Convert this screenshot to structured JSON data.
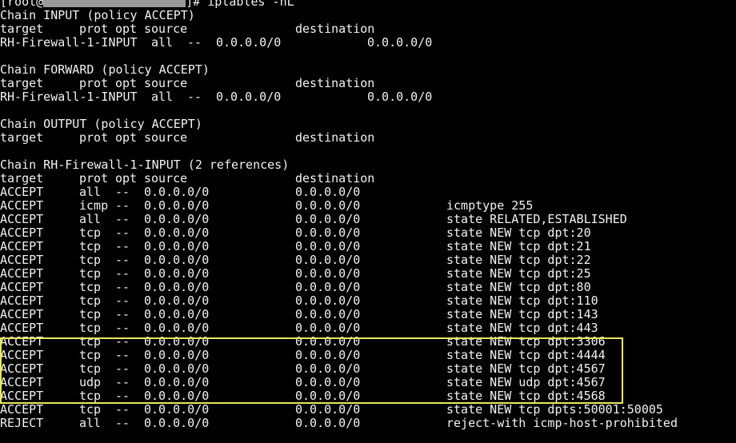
{
  "prompt": {
    "user_host_prefix": "[root@",
    "user_host_suffix": "]#",
    "command": " iptables -nL"
  },
  "chains": {
    "input": {
      "header": "Chain INPUT (policy ACCEPT)",
      "columns": [
        "target",
        "prot",
        "opt",
        "source",
        "destination"
      ],
      "row": {
        "target": "RH-Firewall-1-INPUT",
        "prot": "all",
        "opt": "--",
        "source": "0.0.0.0/0",
        "destination": "0.0.0.0/0"
      }
    },
    "forward": {
      "header": "Chain FORWARD (policy ACCEPT)",
      "columns": [
        "target",
        "prot",
        "opt",
        "source",
        "destination"
      ],
      "row": {
        "target": "RH-Firewall-1-INPUT",
        "prot": "all",
        "opt": "--",
        "source": "0.0.0.0/0",
        "destination": "0.0.0.0/0"
      }
    },
    "output": {
      "header": "Chain OUTPUT (policy ACCEPT)",
      "columns": [
        "target",
        "prot",
        "opt",
        "source",
        "destination"
      ]
    },
    "rh_firewall": {
      "header": "Chain RH-Firewall-1-INPUT (2 references)",
      "columns": [
        "target",
        "prot",
        "opt",
        "source",
        "destination"
      ],
      "rules": [
        {
          "target": "ACCEPT",
          "prot": "all",
          "opt": "--",
          "source": "0.0.0.0/0",
          "destination": "0.0.0.0/0",
          "extra": ""
        },
        {
          "target": "ACCEPT",
          "prot": "icmp",
          "opt": "--",
          "source": "0.0.0.0/0",
          "destination": "0.0.0.0/0",
          "extra": "icmptype 255"
        },
        {
          "target": "ACCEPT",
          "prot": "all",
          "opt": "--",
          "source": "0.0.0.0/0",
          "destination": "0.0.0.0/0",
          "extra": "state RELATED,ESTABLISHED"
        },
        {
          "target": "ACCEPT",
          "prot": "tcp",
          "opt": "--",
          "source": "0.0.0.0/0",
          "destination": "0.0.0.0/0",
          "extra": "state NEW tcp dpt:20"
        },
        {
          "target": "ACCEPT",
          "prot": "tcp",
          "opt": "--",
          "source": "0.0.0.0/0",
          "destination": "0.0.0.0/0",
          "extra": "state NEW tcp dpt:21"
        },
        {
          "target": "ACCEPT",
          "prot": "tcp",
          "opt": "--",
          "source": "0.0.0.0/0",
          "destination": "0.0.0.0/0",
          "extra": "state NEW tcp dpt:22"
        },
        {
          "target": "ACCEPT",
          "prot": "tcp",
          "opt": "--",
          "source": "0.0.0.0/0",
          "destination": "0.0.0.0/0",
          "extra": "state NEW tcp dpt:25"
        },
        {
          "target": "ACCEPT",
          "prot": "tcp",
          "opt": "--",
          "source": "0.0.0.0/0",
          "destination": "0.0.0.0/0",
          "extra": "state NEW tcp dpt:80"
        },
        {
          "target": "ACCEPT",
          "prot": "tcp",
          "opt": "--",
          "source": "0.0.0.0/0",
          "destination": "0.0.0.0/0",
          "extra": "state NEW tcp dpt:110"
        },
        {
          "target": "ACCEPT",
          "prot": "tcp",
          "opt": "--",
          "source": "0.0.0.0/0",
          "destination": "0.0.0.0/0",
          "extra": "state NEW tcp dpt:143"
        },
        {
          "target": "ACCEPT",
          "prot": "tcp",
          "opt": "--",
          "source": "0.0.0.0/0",
          "destination": "0.0.0.0/0",
          "extra": "state NEW tcp dpt:443"
        },
        {
          "target": "ACCEPT",
          "prot": "tcp",
          "opt": "--",
          "source": "0.0.0.0/0",
          "destination": "0.0.0.0/0",
          "extra": "state NEW tcp dpt:3306"
        },
        {
          "target": "ACCEPT",
          "prot": "tcp",
          "opt": "--",
          "source": "0.0.0.0/0",
          "destination": "0.0.0.0/0",
          "extra": "state NEW tcp dpt:4444"
        },
        {
          "target": "ACCEPT",
          "prot": "tcp",
          "opt": "--",
          "source": "0.0.0.0/0",
          "destination": "0.0.0.0/0",
          "extra": "state NEW tcp dpt:4567"
        },
        {
          "target": "ACCEPT",
          "prot": "udp",
          "opt": "--",
          "source": "0.0.0.0/0",
          "destination": "0.0.0.0/0",
          "extra": "state NEW udp dpt:4567"
        },
        {
          "target": "ACCEPT",
          "prot": "tcp",
          "opt": "--",
          "source": "0.0.0.0/0",
          "destination": "0.0.0.0/0",
          "extra": "state NEW tcp dpt:4568"
        },
        {
          "target": "ACCEPT",
          "prot": "tcp",
          "opt": "--",
          "source": "0.0.0.0/0",
          "destination": "0.0.0.0/0",
          "extra": "state NEW tcp dpts:50001:50005"
        },
        {
          "target": "REJECT",
          "prot": "all",
          "opt": "--",
          "source": "0.0.0.0/0",
          "destination": "0.0.0.0/0",
          "extra": "reject-with icmp-host-prohibited"
        }
      ]
    }
  },
  "colors": {
    "background": "#000000",
    "text": "#f2f2f2",
    "redaction": "#9a9a9a",
    "highlight": "#e8e85a"
  }
}
